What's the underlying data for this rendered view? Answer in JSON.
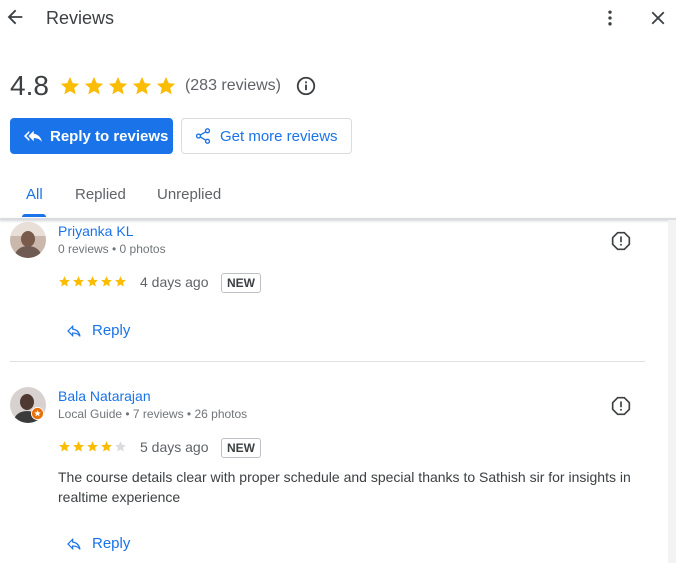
{
  "header": {
    "title": "Reviews",
    "back_icon": "arrow-back-icon",
    "more_icon": "more-vert-icon",
    "close_icon": "close-icon"
  },
  "summary": {
    "rating": "4.8",
    "stars": 5,
    "count_text": "(283 reviews)",
    "info_icon": "info-icon"
  },
  "actions": {
    "reply_label": "Reply to reviews",
    "more_label": "Get more reviews"
  },
  "tabs": [
    {
      "label": "All",
      "active": true
    },
    {
      "label": "Replied"
    },
    {
      "label": "Unreplied"
    }
  ],
  "reviews": [
    {
      "name": "Priyanka KL",
      "meta": "0 reviews • 0 photos",
      "stars": 5,
      "date": "4 days ago",
      "badge": "NEW",
      "text": "",
      "reply_label": "Reply"
    },
    {
      "name": "Bala Natarajan",
      "meta": "Local Guide • 7 reviews • 26 photos",
      "stars": 4,
      "date": "5 days ago",
      "badge": "NEW",
      "text": "The course details clear with proper schedule and special thanks to Sathish sir for insights in realtime experience",
      "reply_label": "Reply"
    }
  ],
  "colors": {
    "accent": "#1a73e8",
    "star": "#fbbc04"
  }
}
